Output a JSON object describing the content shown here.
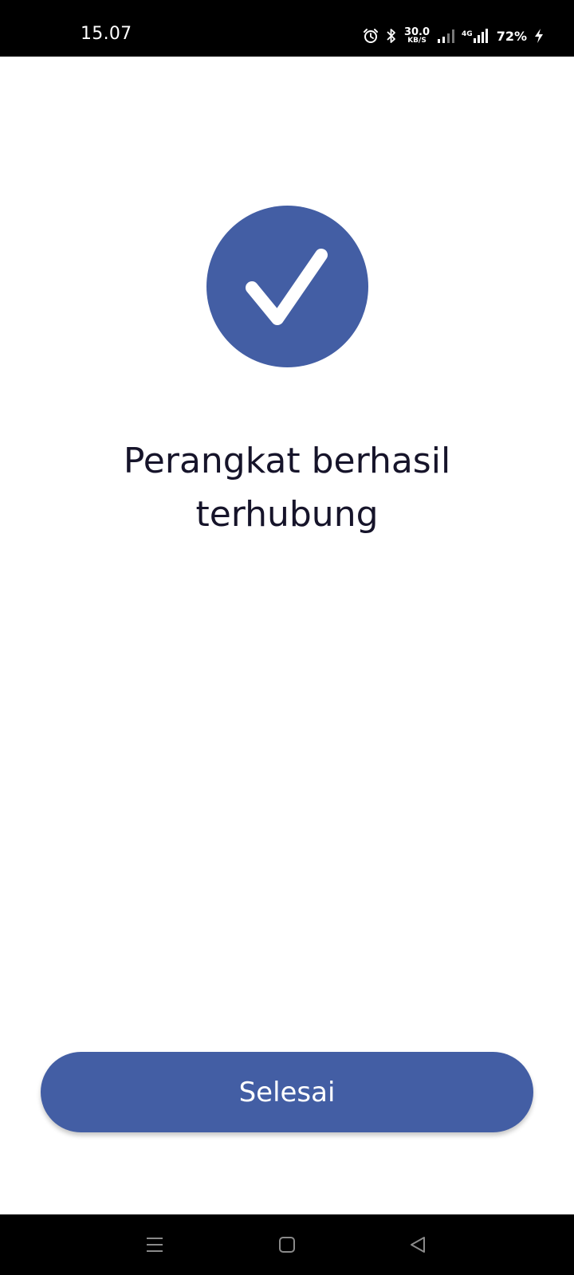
{
  "status_bar": {
    "time": "15.07",
    "net_speed_value": "30.0",
    "net_speed_unit": "KB/S",
    "network_type": "4G",
    "battery_percent": "72%",
    "icons": [
      "alarm-icon",
      "bluetooth-icon",
      "signal-sim1-icon",
      "signal-sim2-icon",
      "charging-icon"
    ]
  },
  "success": {
    "icon": "checkmark-icon",
    "message": "Perangkat berhasil terhubung"
  },
  "actions": {
    "done_label": "Selesai"
  },
  "nav_bar": {
    "icons": [
      "menu-icon",
      "home-icon",
      "back-icon"
    ]
  },
  "colors": {
    "accent": "#435ea4",
    "text": "#16142a",
    "background": "#ffffff",
    "system_bar": "#000000"
  }
}
